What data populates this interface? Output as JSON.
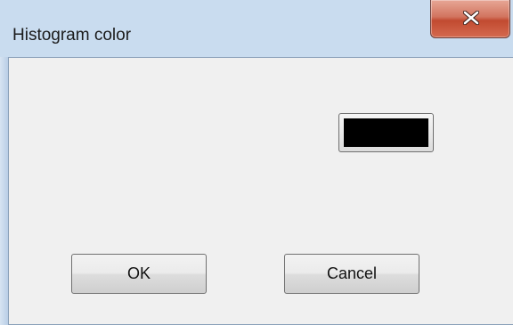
{
  "window": {
    "title": "Histogram color",
    "close_icon": "close-x-icon"
  },
  "color": {
    "value": "#000000"
  },
  "buttons": {
    "ok_label": "OK",
    "cancel_label": "Cancel"
  }
}
